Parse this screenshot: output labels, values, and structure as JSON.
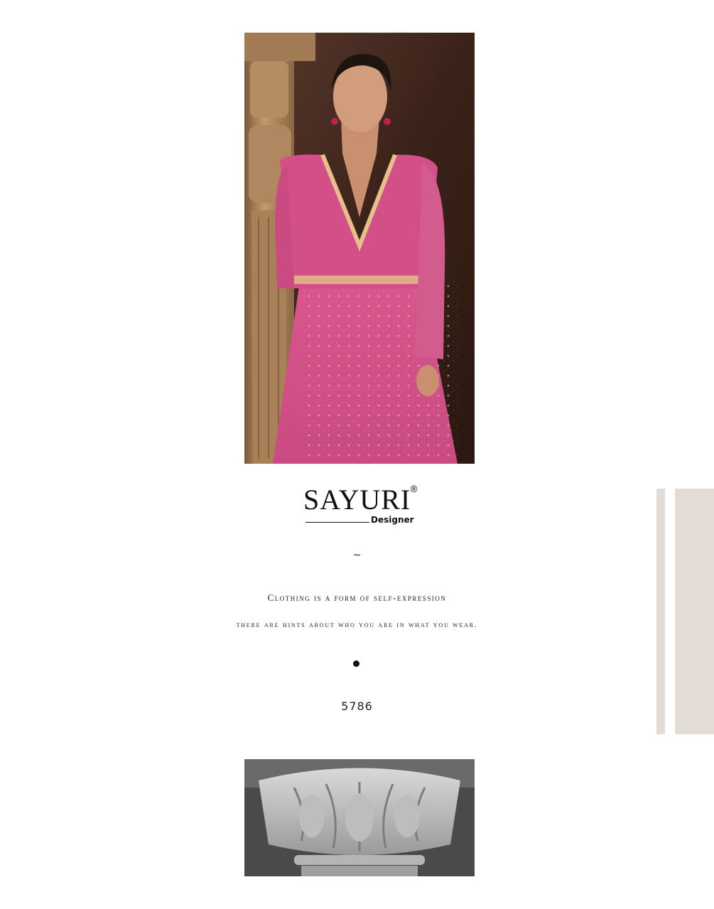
{
  "brand": {
    "name": "SAYURI",
    "registered_mark": "®",
    "subtitle": "Designer"
  },
  "divider_symbol": "~",
  "taglines": [
    "Clothing is a form of self-expression",
    "there are hints about who you are in what you wear."
  ],
  "design_number": "5786",
  "colors": {
    "background": "#ffffff",
    "side_bars": "#e3dbd6",
    "garment_pink": "#d9568e",
    "dupatta_magenta": "#c2185b"
  }
}
